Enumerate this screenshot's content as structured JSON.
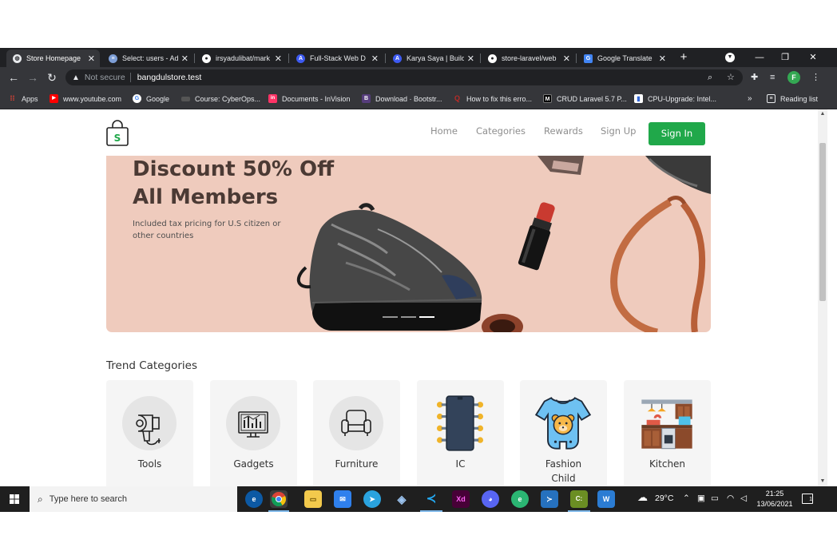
{
  "browser": {
    "tabs": [
      {
        "title": "Store Homepage",
        "icon": "globe-icon",
        "color": "#e8eaed",
        "glyph": "◍",
        "active": true
      },
      {
        "title": "Select: users - Ad",
        "icon": "database-icon",
        "color": "#7d9ed6",
        "glyph": "≡",
        "active": false
      },
      {
        "title": "irsyadulibat/mark",
        "icon": "github-icon",
        "color": "#ffffff",
        "glyph": "●",
        "active": false
      },
      {
        "title": "Full-Stack Web D",
        "icon": "buildwith-angga-icon",
        "color": "#3d5af1",
        "glyph": "A",
        "active": false
      },
      {
        "title": "Karya Saya | Build",
        "icon": "buildwith-angga-icon",
        "color": "#3d5af1",
        "glyph": "A",
        "active": false
      },
      {
        "title": "store-laravel/web",
        "icon": "github-icon",
        "color": "#ffffff",
        "glyph": "●",
        "active": false
      },
      {
        "title": "Google Translate",
        "icon": "translate-icon",
        "color": "#4285f4",
        "glyph": "G",
        "active": false
      }
    ],
    "address": {
      "security_label": "Not secure",
      "url": "bangdulstore.test"
    },
    "profile_initial": "F",
    "bookmarks": [
      {
        "label": "Apps",
        "icon": "apps-grid-icon",
        "color": "#ea4335",
        "glyph": "⋮⋮"
      },
      {
        "label": "www.youtube.com",
        "icon": "youtube-icon",
        "color": "#ff0000",
        "glyph": "▶"
      },
      {
        "label": "Google",
        "icon": "google-icon",
        "color": "#4285f4",
        "glyph": "G"
      },
      {
        "label": "Course: CyberOps...",
        "icon": "course-icon",
        "color": "#555555",
        "glyph": "▬"
      },
      {
        "label": "Documents - InVision",
        "icon": "invision-icon",
        "color": "#ff3366",
        "glyph": "in"
      },
      {
        "label": "Download · Bootstr...",
        "icon": "bootstrap-icon",
        "color": "#563d7c",
        "glyph": "B"
      },
      {
        "label": "How to fix this erro...",
        "icon": "quora-icon",
        "color": "#b92b27",
        "glyph": "Q"
      },
      {
        "label": "CRUD Laravel 5.7 P...",
        "icon": "medium-icon",
        "color": "#000000",
        "glyph": "M"
      },
      {
        "label": "CPU-Upgrade: Intel...",
        "icon": "cpu-chart-icon",
        "color": "#3367d6",
        "glyph": "▮"
      },
      {
        "label": "Reading list",
        "icon": "reading-list-icon",
        "color": "#35363a",
        "glyph": "☰"
      }
    ]
  },
  "site": {
    "logo_letter": "S",
    "nav": [
      "Home",
      "Categories",
      "Rewards",
      "Sign Up"
    ],
    "signin_label": "Sign In",
    "hero": {
      "title_line1": "Discount 50% Off",
      "title_line2": "All Members",
      "subtitle": "Included tax pricing for U.S citizen or other countries",
      "slides": 3,
      "active_slide": 3
    },
    "trend_title": "Trend Categories",
    "categories": [
      {
        "name": "Tools",
        "icon": "hair-dryer-icon"
      },
      {
        "name": "Gadgets",
        "icon": "monitor-chart-icon"
      },
      {
        "name": "Furniture",
        "icon": "armchair-icon"
      },
      {
        "name": "IC",
        "icon": "microchip-icon"
      },
      {
        "name": "Fashion Child",
        "icon": "baby-romper-icon"
      },
      {
        "name": "Kitchen",
        "icon": "kitchen-icon"
      }
    ]
  },
  "taskbar": {
    "search_placeholder": "Type here to search",
    "weather": "29°C",
    "time": "21:25",
    "date": "13/06/2021",
    "notifications": "1",
    "apps": [
      {
        "name": "edge-icon",
        "color": "#0c8ce9",
        "glyph": "e"
      },
      {
        "name": "chrome-icon",
        "color": "#4caf50",
        "glyph": "◉"
      },
      {
        "name": "file-explorer-icon",
        "color": "#f2c94c",
        "glyph": "▭"
      },
      {
        "name": "mail-icon",
        "color": "#2f80ed",
        "glyph": "✉"
      },
      {
        "name": "telegram-icon",
        "color": "#2aa3df",
        "glyph": "➤"
      },
      {
        "name": "virtualbox-icon",
        "color": "#7fb3e8",
        "glyph": "◈"
      },
      {
        "name": "vscode-icon",
        "color": "#1f8ad2",
        "glyph": "≺"
      },
      {
        "name": "adobe-xd-icon",
        "color": "#470137",
        "glyph": "Xd"
      },
      {
        "name": "discord-icon",
        "color": "#5865f2",
        "glyph": "◕"
      },
      {
        "name": "edge-dev-icon",
        "color": "#2bb673",
        "glyph": "e"
      },
      {
        "name": "powershell-icon",
        "color": "#2671be",
        "glyph": "≻"
      },
      {
        "name": "terminal-icon",
        "color": "#4d7c0f",
        "glyph": "C:"
      },
      {
        "name": "word-icon",
        "color": "#2b7cd3",
        "glyph": "W"
      }
    ]
  }
}
